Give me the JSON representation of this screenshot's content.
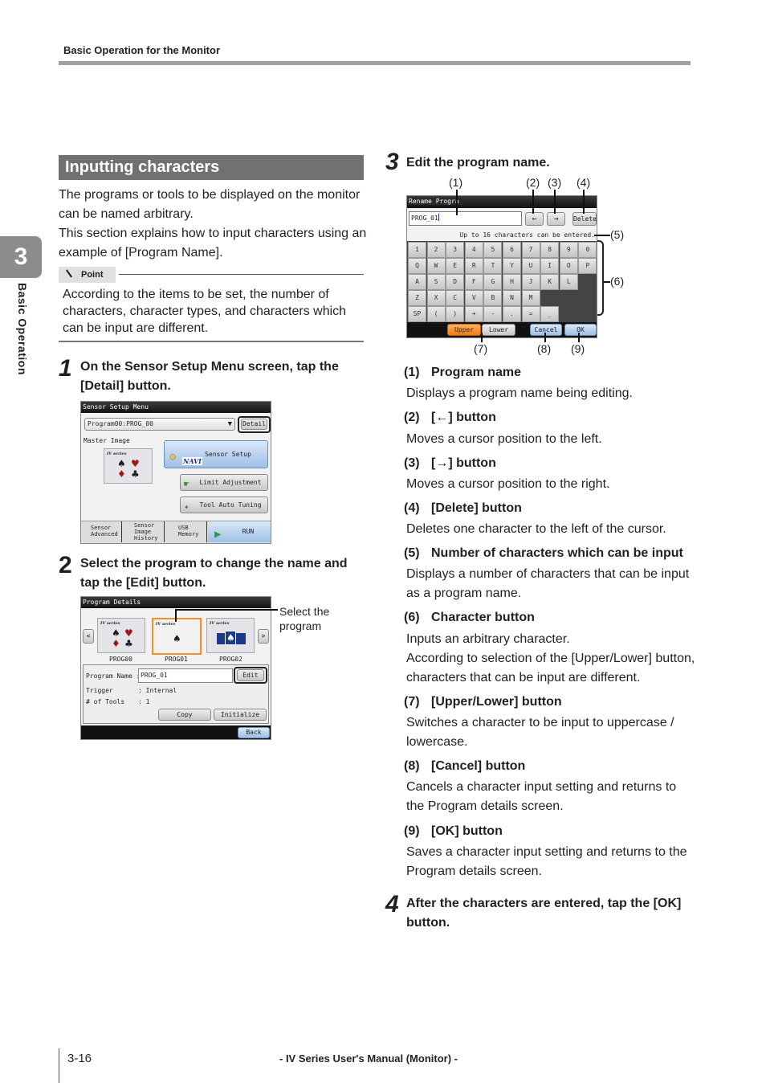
{
  "header": {
    "running_head": "Basic Operation for the Monitor"
  },
  "side_tab": {
    "chapter_number": "3",
    "chapter_label": "Basic Operation"
  },
  "section": {
    "title": "Inputting characters",
    "intro_1": "The programs or tools to be displayed on the monitor can be named arbitrary.",
    "intro_2": "This section explains how to input characters using an example of [Program Name]."
  },
  "point": {
    "label": "Point",
    "text": "According to the items to be set, the number of characters, character types, and characters which can be input are different."
  },
  "steps": [
    {
      "number": "1",
      "text": "On the Sensor Setup Menu screen, tap the [Detail] button."
    },
    {
      "number": "2",
      "text": "Select the program to change the name and tap the [Edit] button."
    },
    {
      "number": "3",
      "text": "Edit the program name."
    },
    {
      "number": "4",
      "text": "After the characters are entered, tap the [OK] button."
    }
  ],
  "screen_sensor_setup": {
    "title": "Sensor Setup Menu",
    "program_select": "Program00:PROG_00",
    "detail_button": "Detail",
    "master_image_label": "Master Image",
    "thumb_series": "IV series",
    "sensor_setup_button": "Sensor Setup",
    "navi_label": "NAVI",
    "limit_adjustment_button": "Limit Adjustment",
    "tool_auto_tuning_button": "Tool Auto Tuning",
    "bottom_tabs": [
      "Sensor Advanced",
      "Sensor Image History",
      "USB Memory",
      "RUN"
    ]
  },
  "screen_program_details": {
    "title": "Program Details",
    "prev_button": "<",
    "next_button": ">",
    "thumb_series": "IV series",
    "programs": [
      "PROG00",
      "PROG01",
      "PROG02"
    ],
    "selected_program_index": 1,
    "program_name_label": "Program Name :",
    "program_name_value": "PROG_01",
    "edit_button": "Edit",
    "trigger_label": "Trigger",
    "trigger_value": ": Internal",
    "tools_label": "# of Tools",
    "tools_value": ": 1",
    "copy_button": "Copy",
    "initialize_button": "Initialize",
    "back_button": "Back",
    "annotation": "Select the program"
  },
  "screen_rename": {
    "title": "Rename Progra",
    "name_value": "PROG_01",
    "left_button": "←",
    "right_button": "→",
    "delete_button": "Delete",
    "limit_text": "Up to 16 characters can be entered.",
    "keys": [
      [
        "1",
        "2",
        "3",
        "4",
        "5",
        "6",
        "7",
        "8",
        "9",
        "0"
      ],
      [
        "Q",
        "W",
        "E",
        "R",
        "T",
        "Y",
        "U",
        "I",
        "O",
        "P"
      ],
      [
        "A",
        "S",
        "D",
        "F",
        "G",
        "H",
        "J",
        "K",
        "L"
      ],
      [
        "Z",
        "X",
        "C",
        "V",
        "B",
        "N",
        "M"
      ],
      [
        "SP",
        "(",
        ")",
        "+",
        "-",
        ".",
        "=",
        "_"
      ]
    ],
    "upper_button": "Upper",
    "lower_button": "Lower",
    "cancel_button": "Cancel",
    "ok_button": "OK",
    "callouts": [
      "(1)",
      "(2)",
      "(3)",
      "(4)",
      "(5)",
      "(6)",
      "(7)",
      "(8)",
      "(9)"
    ]
  },
  "descriptions": [
    {
      "num": "(1)",
      "title": "Program name",
      "body": "Displays a program name being editing."
    },
    {
      "num": "(2)",
      "title": "[←] button",
      "body": "Moves a cursor position to the left."
    },
    {
      "num": "(3)",
      "title": "[→] button",
      "body": "Moves a cursor position to the right."
    },
    {
      "num": "(4)",
      "title": "[Delete] button",
      "body": "Deletes one character to the left of the cursor."
    },
    {
      "num": "(5)",
      "title": "Number of characters which can be input",
      "body": "Displays a number of characters that can be input as a program name."
    },
    {
      "num": "(6)",
      "title": "Character button",
      "body": "Inputs an arbitrary character.",
      "body2": "According to selection of the [Upper/Lower] button, characters that can be input are different."
    },
    {
      "num": "(7)",
      "title": "[Upper/Lower] button",
      "body": "Switches a character to be input to uppercase / lowercase."
    },
    {
      "num": "(8)",
      "title": "[Cancel] button",
      "body": "Cancels a character input setting and returns to the Program details screen."
    },
    {
      "num": "(9)",
      "title": "[OK] button",
      "body": "Saves a character input setting and returns to the Program details screen."
    }
  ],
  "footer": {
    "page_number": "3-16",
    "manual_title": "- IV Series User's Manual (Monitor) -"
  }
}
